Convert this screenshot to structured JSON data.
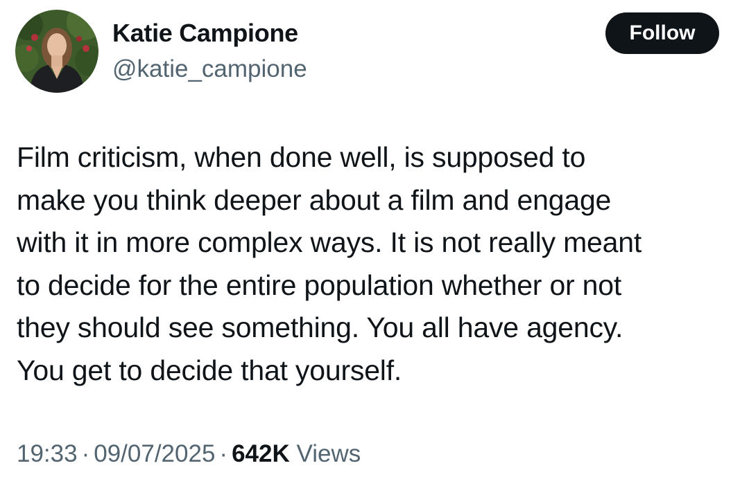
{
  "author": {
    "display_name": "Katie Campione",
    "handle": "@katie_campione"
  },
  "follow_label": "Follow",
  "tweet": {
    "lines": [
      "Film criticism, when done well, is supposed to",
      "make you think deeper about a film and engage",
      "with it in more complex ways. It is not really meant",
      "to decide for the entire population whether or not",
      "they should see something. You all have agency.",
      "You get to decide that yourself."
    ]
  },
  "meta": {
    "time": "19:33",
    "separator": "·",
    "date": "09/07/2025",
    "views_count": "642K",
    "views_label": "Views"
  },
  "colors": {
    "text_primary": "#0f1419",
    "text_secondary": "#536471",
    "follow_bg": "#0f1419",
    "follow_text": "#ffffff"
  }
}
